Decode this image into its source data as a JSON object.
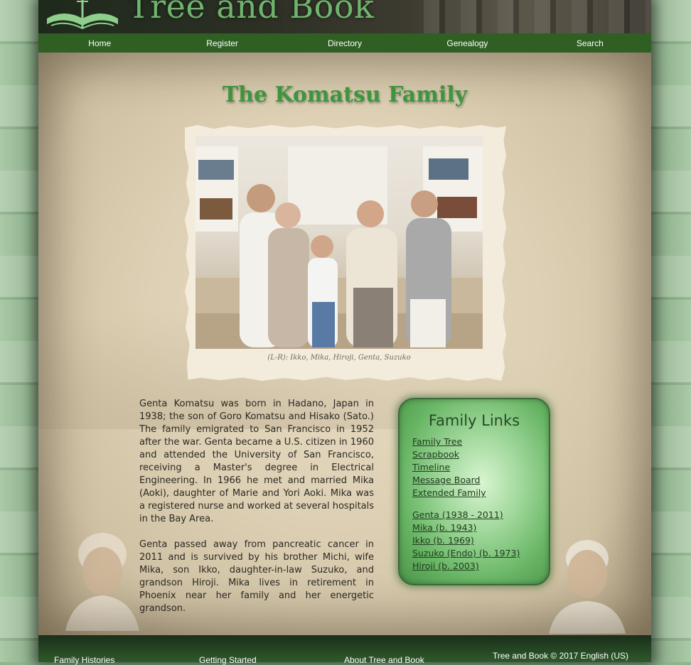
{
  "site": {
    "title": "Tree and Book",
    "logo_icon": "tree-book-logo-icon"
  },
  "nav": {
    "items": [
      "Home",
      "Register",
      "Directory",
      "Genealogy",
      "Search"
    ]
  },
  "family": {
    "title": "The Komatsu Family",
    "photo_caption": "(L-R): Ikko, Mika, Hiroji, Genta, Suzuko",
    "bio": [
      "Genta Komatsu was born in Hadano, Japan in 1938; the son of Goro Komatsu and Hisako (Sato.) The family emigrated to San Francisco in 1952 after the war. Genta became a U.S. citizen in 1960 and attended the University of San Francisco, receiving a Master's degree in Electrical Engineering. In 1966 he met and married Mika (Aoki), daughter of Marie and Yori Aoki. Mika was a registered nurse and worked at several hospitals in the Bay Area.",
      "Genta passed away from pancreatic cancer in 2011 and is survived by his brother Michi, wife Mika, son Ikko, daughter-in-law Suzuko, and grandson Hiroji. Mika lives in retirement in Phoenix near her family and her energetic grandson."
    ]
  },
  "links_box": {
    "title": "Family Links",
    "pages": [
      "Family Tree",
      "Scrapbook",
      "Timeline",
      "Message Board",
      "Extended Family"
    ],
    "members": [
      "Genta (1938 - 2011)",
      "Mika (b. 1943)",
      "Ikko (b. 1969)",
      "Suzuko (Endo) (b. 1973)",
      "Hiroji (b. 2003)"
    ]
  },
  "footer": {
    "links": [
      "Family Histories",
      "Getting Started",
      "About Tree and Book"
    ],
    "copyright": "Tree and Book © 2017 English (US)"
  },
  "colors": {
    "nav_bg": "#2f5f23",
    "title_green": "#3f9a3f",
    "links_box_green": "#66b463"
  }
}
